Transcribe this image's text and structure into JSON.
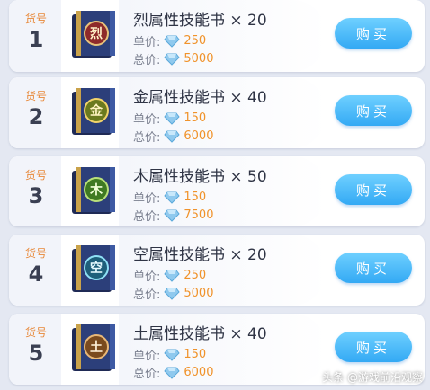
{
  "items": [
    {
      "id_label": "货号",
      "id": "1",
      "title": "烈属性技能书 × 20",
      "unit_label": "单价:",
      "unit_price": "250",
      "total_label": "总价:",
      "total_price": "5000",
      "buy_label": "购买",
      "emblem_char": "烈",
      "emblem_color": "#c9423a"
    },
    {
      "id_label": "货号",
      "id": "2",
      "title": "金属性技能书 × 40",
      "unit_label": "单价:",
      "unit_price": "150",
      "total_label": "总价:",
      "total_price": "6000",
      "buy_label": "购买",
      "emblem_char": "金",
      "emblem_color": "#d9a62a"
    },
    {
      "id_label": "货号",
      "id": "3",
      "title": "木属性技能书 × 50",
      "unit_label": "单价:",
      "unit_price": "150",
      "total_label": "总价:",
      "total_price": "7500",
      "buy_label": "购买",
      "emblem_char": "木",
      "emblem_color": "#6aa72d"
    },
    {
      "id_label": "货号",
      "id": "4",
      "title": "空属性技能书 × 20",
      "unit_label": "单价:",
      "unit_price": "250",
      "total_label": "总价:",
      "total_price": "5000",
      "buy_label": "购买",
      "emblem_char": "空",
      "emblem_color": "#2fa6c4"
    },
    {
      "id_label": "货号",
      "id": "5",
      "title": "土属性技能书 × 40",
      "unit_label": "单价:",
      "unit_price": "150",
      "total_label": "总价:",
      "total_price": "6000",
      "buy_label": "购买",
      "emblem_char": "土",
      "emblem_color": "#b07a3a"
    }
  ],
  "watermark": "头条 @游戏前沿观察",
  "colors": {
    "accent_orange": "#f0932b",
    "buy_button": "#33a9f4",
    "book_cover": "#2c3f7a"
  },
  "icons": {
    "price_icon": "diamond-icon",
    "item_icon": "skill-book-icon"
  }
}
